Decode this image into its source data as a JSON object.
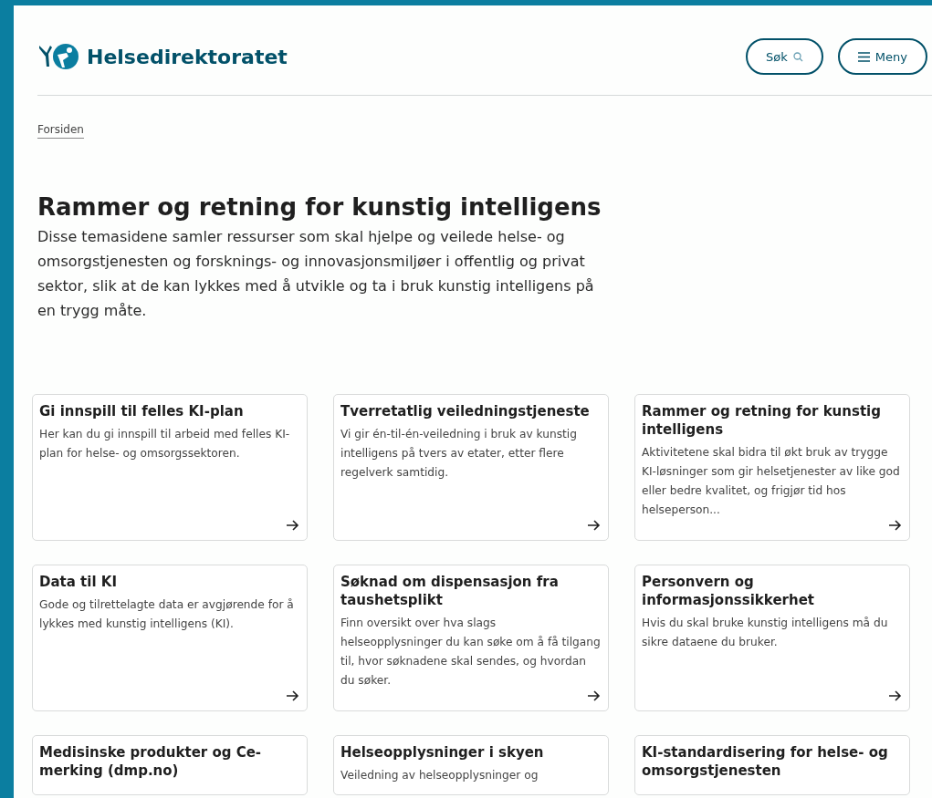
{
  "header": {
    "site_name": "Helsedirektoratet",
    "buttons": [
      {
        "kind": "search",
        "label": "Søk"
      },
      {
        "kind": "menu",
        "label": "Meny"
      }
    ]
  },
  "breadcrumb": [
    "Forsiden"
  ],
  "title": "Rammer og retning for kunstig intelligens",
  "intro": "Disse temasidene samler ressurser som skal hjelpe og veilede helse- og omsorgstjenesten og forsknings- og innovasjonsmiljøer i offentlig og privat sektor, slik at de kan lykkes med å utvikle og ta i bruk kunstig intelligens på en trygg måte.",
  "cards": [
    {
      "title": "Gi innspill til felles KI-plan",
      "description": "Her kan du gi innspill til arbeid med felles KI-plan for helse- og omsorgssektoren.",
      "arrow": true
    },
    {
      "title": "Tverretatlig veiledningstjeneste",
      "description": "Vi gir én-til-én-veiledning i bruk av kunstig intelligens på tvers av etater, etter flere regelverk samtidig.",
      "arrow": true
    },
    {
      "title": "Rammer og retning for kunstig intelligens",
      "description": "Aktivitetene skal bidra til økt bruk av trygge KI-løsninger som gir helsetjenester av like god eller bedre kvalitet, og frigjør tid hos helseperson...",
      "arrow": true
    },
    {
      "title": "Data til KI",
      "description": "Gode og tilrettelagte data er avgjørende for å lykkes med kunstig intelligens (KI).",
      "arrow": true
    },
    {
      "title": "Søknad om dispensasjon fra taushetsplikt",
      "description": "Finn oversikt over hva slags helseopplysninger du kan søke om å få tilgang til, hvor søknadene skal sendes, og hvordan du søker.",
      "arrow": true
    },
    {
      "title": "Personvern og informasjonssikkerhet",
      "description": "Hvis du skal bruke kunstig intelligens må du sikre dataene du bruker.",
      "arrow": true
    },
    {
      "title": "Medisinske produkter og Ce-merking (dmp.no)"
    },
    {
      "title": "Helseopplysninger i skyen",
      "description": "Veiledning av helseopplysninger og"
    },
    {
      "title": "KI-standardisering for helse- og omsorgstjenesten"
    }
  ]
}
